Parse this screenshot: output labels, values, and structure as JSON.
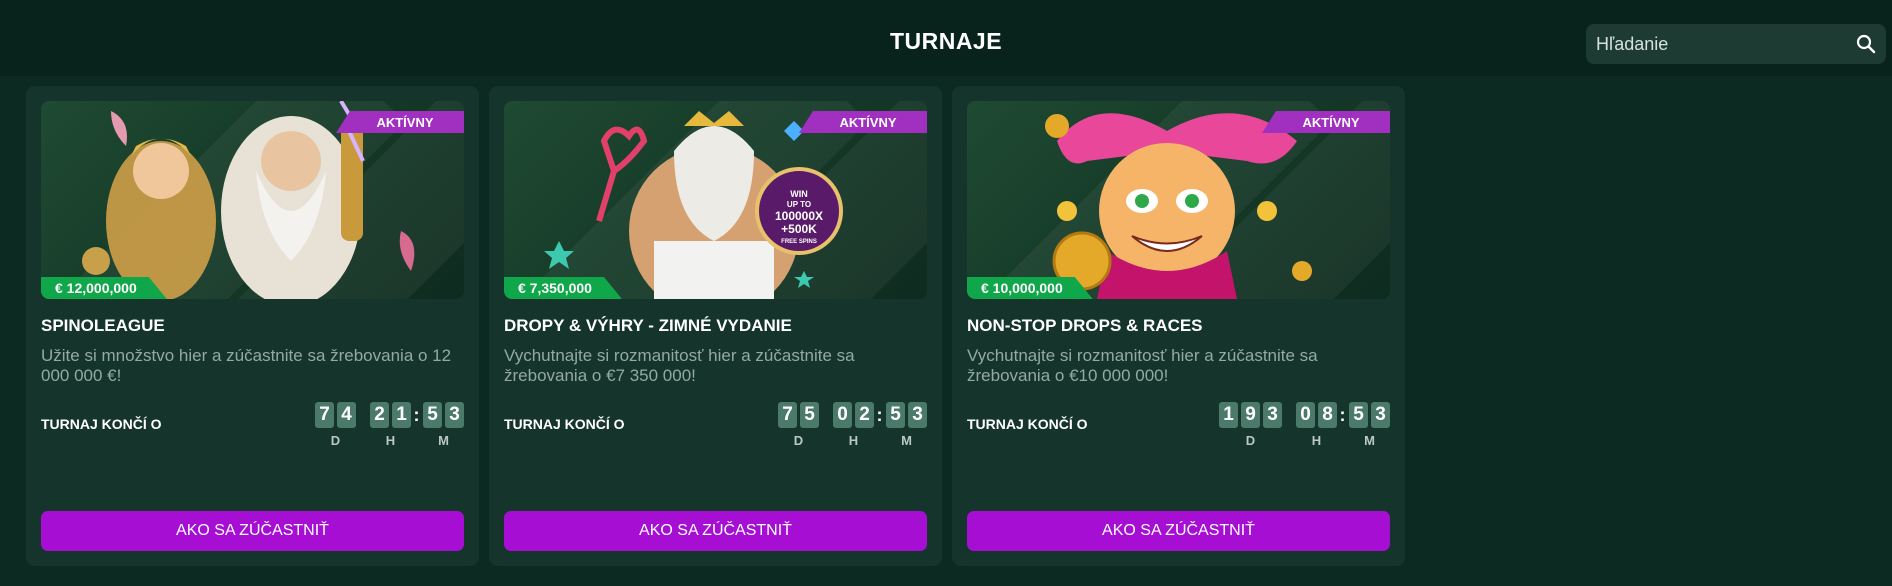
{
  "header": {
    "title": "TURNAJE",
    "search_placeholder": "Hľadanie",
    "search_icon": "search-icon"
  },
  "colors": {
    "background": "#0d2a22",
    "card": "#15342c",
    "badge": "#a12fc0",
    "prize": "#0fa74a",
    "button": "#a60fd3",
    "digit": "#4b7a6b"
  },
  "tournaments": [
    {
      "status": "AKTÍVNY",
      "prize": "€ 12,000,000",
      "title": "SPINOLEAGUE",
      "description": "Užite si množstvo hier a zúčastnite sa žrebovania o 12 000 000 €!",
      "ends_label": "TURNAJ KONČÍ O",
      "countdown": {
        "days": "74",
        "hours": "21",
        "minutes": "53"
      },
      "units": {
        "d": "D",
        "h": "H",
        "m": "M"
      },
      "button": "AKO SA ZÚČASTNIŤ"
    },
    {
      "status": "AKTÍVNY",
      "prize": "€ 7,350,000",
      "title": "DROPY & VÝHRY - ZIMNÉ VYDANIE",
      "description": "Vychutnajte si rozmanitosť hier a zúčastnite sa žrebovania o €7 350 000!",
      "ends_label": "TURNAJ KONČÍ O",
      "countdown": {
        "days": "75",
        "hours": "02",
        "minutes": "53"
      },
      "units": {
        "d": "D",
        "h": "H",
        "m": "M"
      },
      "button": "AKO SA ZÚČASTNIŤ",
      "art_text": {
        "line1": "WIN",
        "line2": "UP TO",
        "line3": "100000X",
        "line4": "+500K",
        "line5": "FREE SPINS"
      }
    },
    {
      "status": "AKTÍVNY",
      "prize": "€ 10,000,000",
      "title": "NON-STOP DROPS & RACES",
      "description": "Vychutnajte si rozmanitosť hier a zúčastnite sa žrebovania o €10 000 000!",
      "ends_label": "TURNAJ KONČÍ O",
      "countdown": {
        "days": "193",
        "hours": "08",
        "minutes": "53"
      },
      "units": {
        "d": "D",
        "h": "H",
        "m": "M"
      },
      "button": "AKO SA ZÚČASTNIŤ"
    }
  ]
}
